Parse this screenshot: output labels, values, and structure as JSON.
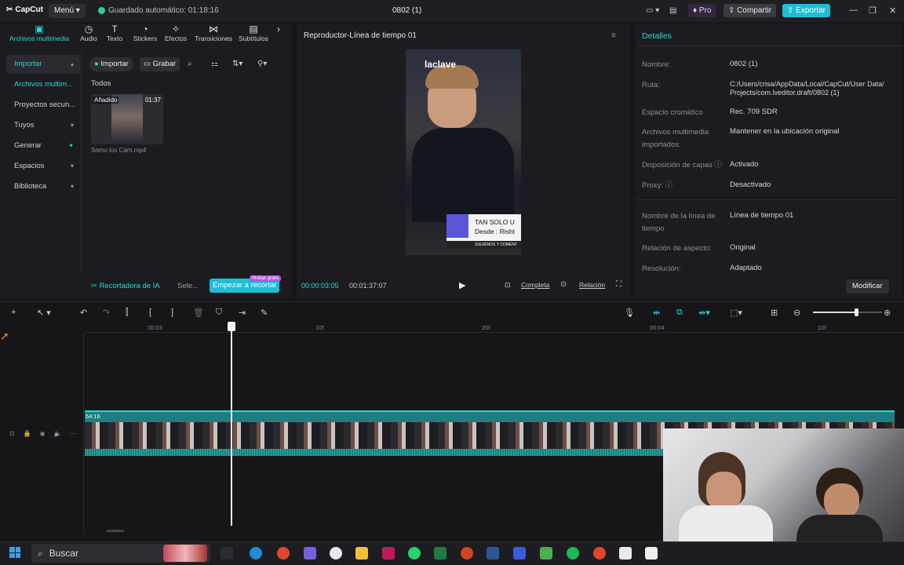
{
  "app": {
    "name": "CapCut",
    "menu": "Menú"
  },
  "header": {
    "autosave": "Guardado automático: 01:18:16",
    "project_title": "0802 (1)",
    "pro": "Pro",
    "share": "Compartir",
    "export": "Exportar"
  },
  "media_tabs": [
    {
      "label": "Archivos multimedia",
      "icon": "media-icon"
    },
    {
      "label": "Audio",
      "icon": "audio-icon"
    },
    {
      "label": "Texto",
      "icon": "text-icon"
    },
    {
      "label": "Stickers",
      "icon": "sticker-icon"
    },
    {
      "label": "Efectos",
      "icon": "effects-icon"
    },
    {
      "label": "Transiciones",
      "icon": "transitions-icon"
    },
    {
      "label": "Subtítulos",
      "icon": "subtitles-icon"
    }
  ],
  "sidebar": {
    "items": [
      {
        "label": "Importar"
      },
      {
        "label": "Archivos multim..."
      },
      {
        "label": "Proyectos secun..."
      },
      {
        "label": "Tuyos"
      },
      {
        "label": "Generar"
      },
      {
        "label": "Espacios"
      },
      {
        "label": "Biblioteca"
      }
    ]
  },
  "media": {
    "import": "Importar",
    "record": "Grabar",
    "filter": "Todos",
    "clip": {
      "badge": "Añadido",
      "duration": "01:37",
      "name": "Somo los Cam.mp4"
    }
  },
  "ai_bar": {
    "label": "Recortadora de IA",
    "select": "Sele...",
    "start": "Empezar a recortar",
    "free_badge": "Probar gratis"
  },
  "player": {
    "title": "Reproductor-Línea de tiempo 01",
    "current_time": "00:00:03:05",
    "total_time": "00:01:37:07",
    "full": "Completa",
    "ratio": "Relación",
    "overlay_top": "laclave",
    "overlay_card_line1": "TAN SOLO U",
    "overlay_card_line2": "Desde : Risht",
    "overlay_card_line3": "SIGUENOS Y COMENT"
  },
  "details": {
    "title": "Detalles",
    "rows": [
      {
        "label": "Nombre:",
        "value": "0802 (1)"
      },
      {
        "label": "Ruta:",
        "value": "C:/Users/crisa/AppData/Local/CapCut/User Data/\nProjects/com.lveditor.draft/0802 (1)"
      },
      {
        "label": "Espacio cromático",
        "value": "Rec. 709 SDR"
      },
      {
        "label": "Archivos multimedia importados:",
        "value": "Mantener en la ubicación original"
      },
      {
        "label": "Disposición de capas ⓘ",
        "value": "Activado"
      },
      {
        "label": "Proxy: ⓘ",
        "value": "Desactivado"
      },
      {
        "label": "Nombre de la línea de tiempo",
        "value": "Línea de tiempo 01"
      },
      {
        "label": "Relación de aspecto:",
        "value": "Original"
      },
      {
        "label": "Resolución:",
        "value": "Adaptado"
      }
    ],
    "modify": "Modificar"
  },
  "timeline": {
    "ticks": [
      "00:03",
      "10f",
      "20f",
      "00:04",
      "10f"
    ],
    "clip_duration": "54:16"
  },
  "taskbar": {
    "search": "Buscar"
  },
  "colors": {
    "accent": "#2dd6d6",
    "export": "#1fbdd6",
    "clip": "#1c7f7d"
  }
}
